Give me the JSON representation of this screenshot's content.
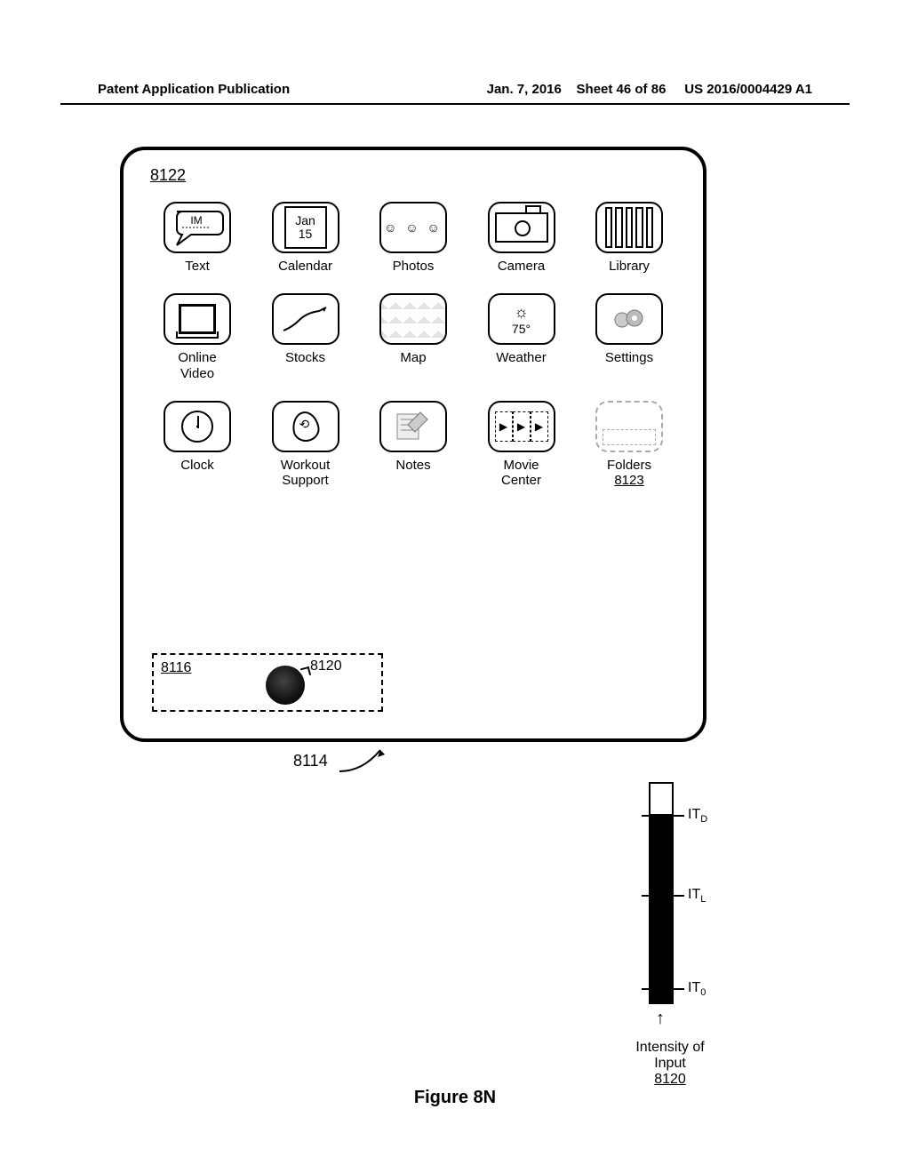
{
  "header": {
    "left": "Patent Application Publication",
    "date": "Jan. 7, 2016",
    "sheet": "Sheet 46 of 86",
    "pubno": "US 2016/0004429 A1"
  },
  "refs": {
    "screen": "8122",
    "dock": "8116",
    "touch": "8120",
    "device": "8114",
    "folders": "8123"
  },
  "apps": {
    "r1": [
      {
        "label": "Text",
        "im": "IM"
      },
      {
        "label": "Calendar",
        "month": "Jan",
        "day": "15"
      },
      {
        "label": "Photos"
      },
      {
        "label": "Camera"
      },
      {
        "label": "Library"
      }
    ],
    "r2": [
      {
        "label": "Online\nVideo"
      },
      {
        "label": "Stocks"
      },
      {
        "label": "Map"
      },
      {
        "label": "Weather",
        "temp": "75°"
      },
      {
        "label": "Settings"
      }
    ],
    "r3": [
      {
        "label": "Clock"
      },
      {
        "label": "Workout\nSupport"
      },
      {
        "label": "Notes"
      },
      {
        "label": "Movie\nCenter"
      },
      {
        "label": "Folders"
      }
    ]
  },
  "intensity": {
    "caption_line1": "Intensity of",
    "caption_line2": "Input",
    "caption_ref": "8120",
    "ticks": {
      "d": "IT",
      "l": "IT",
      "zero": "IT",
      "d_sub": "D",
      "l_sub": "L",
      "zero_sub": "0"
    }
  },
  "figure_caption": "Figure 8N"
}
